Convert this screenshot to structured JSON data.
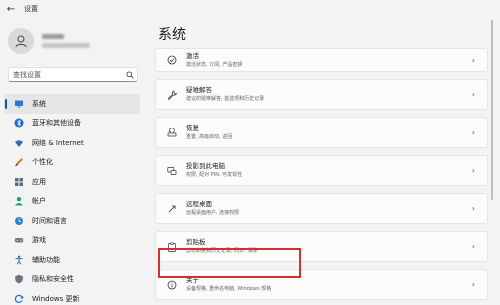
{
  "app": {
    "title": "设置"
  },
  "search": {
    "placeholder": "查找设置"
  },
  "sidebar": {
    "items": [
      {
        "label": "系统",
        "icon": "monitor-icon",
        "selected": true
      },
      {
        "label": "蓝牙和其他设备",
        "icon": "bluetooth-icon"
      },
      {
        "label": "网络 & Internet",
        "icon": "wifi-icon"
      },
      {
        "label": "个性化",
        "icon": "paintbrush-icon"
      },
      {
        "label": "应用",
        "icon": "apps-icon"
      },
      {
        "label": "帐户",
        "icon": "account-icon"
      },
      {
        "label": "时间和语言",
        "icon": "globe-clock-icon"
      },
      {
        "label": "游戏",
        "icon": "gamepad-icon"
      },
      {
        "label": "辅助功能",
        "icon": "accessibility-icon"
      },
      {
        "label": "隐私和安全性",
        "icon": "shield-icon"
      },
      {
        "label": "Windows 更新",
        "icon": "update-icon"
      }
    ]
  },
  "main": {
    "title": "系统",
    "cards": [
      {
        "title": "激活",
        "desc": "激活状态, 订阅, 产品密钥",
        "icon": "activation-check-icon"
      },
      {
        "title": "疑难解答",
        "desc": "建议的疑难解答, 首选项和历史记录",
        "icon": "wrench-icon"
      },
      {
        "title": "恢复",
        "desc": "重置, 高级启动, 返回",
        "icon": "recovery-icon"
      },
      {
        "title": "投影到此电脑",
        "desc": "权限, 配对 PIN, 可发现性",
        "icon": "projector-icon"
      },
      {
        "title": "远程桌面",
        "desc": "远程桌面用户, 连接权限",
        "icon": "remote-desktop-icon"
      },
      {
        "title": "剪贴板",
        "desc": "剪切和复制历史记录, 同步, 清除",
        "icon": "clipboard-icon"
      },
      {
        "title": "关于",
        "desc": "设备规格, 重命名电脑, Windows 规格",
        "icon": "info-icon",
        "highlighted": true
      }
    ]
  },
  "colors": {
    "accent": "#005fb8",
    "highlight": "#d43030"
  }
}
